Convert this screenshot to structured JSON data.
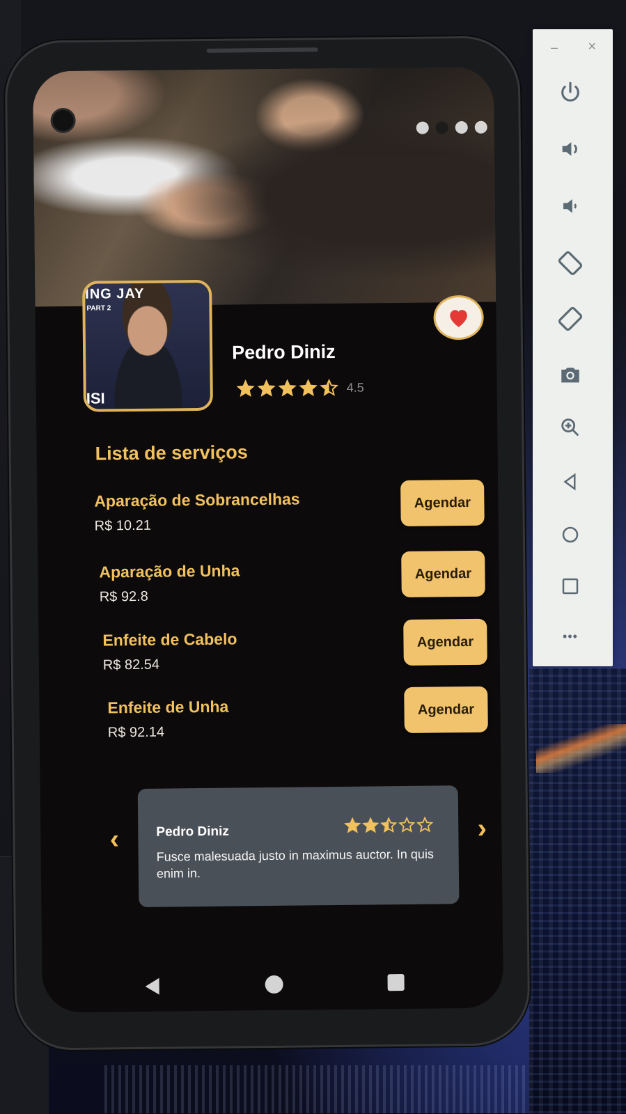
{
  "emulator": {
    "minimize_label": "–",
    "close_label": "×",
    "more_label": "•••"
  },
  "desktop": {
    "dialog_close_label": "×"
  },
  "profile": {
    "name": "Pedro Diniz",
    "rating": 4.5,
    "rating_label": "4.5",
    "photo_banner": "ING JAY",
    "photo_banner_sub": "PART 2",
    "photo_banner_bottom": "ISI"
  },
  "hero": {
    "page_count": 4,
    "active_page_index": 1
  },
  "services_section": {
    "title": "Lista de serviços",
    "items": [
      {
        "name": "Aparação de Sobrancelhas",
        "price": "R$ 10.21",
        "button_label": "Agendar"
      },
      {
        "name": "Aparação de Unha",
        "price": "R$ 92.8",
        "button_label": "Agendar"
      },
      {
        "name": "Enfeite de Cabelo",
        "price": "R$ 82.54",
        "button_label": "Agendar"
      },
      {
        "name": "Enfeite de Unha",
        "price": "R$ 92.14",
        "button_label": "Agendar"
      }
    ]
  },
  "review": {
    "author": "Pedro Diniz",
    "rating": 2.5,
    "text": "Fusce malesuada justo in maximus auctor. In quis enim in.",
    "prev_label": "‹",
    "next_label": "›"
  },
  "colors": {
    "accent": "#f1c15e",
    "button_bg": "#f0c36c",
    "screen_bg": "#0c0a0b",
    "card_bg": "#4a5058",
    "heart": "#e53935"
  }
}
